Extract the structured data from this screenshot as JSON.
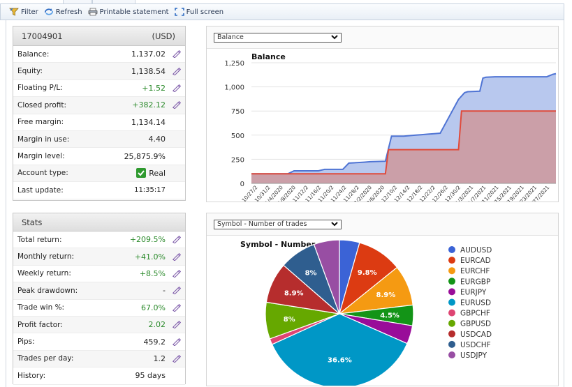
{
  "toolbar": {
    "filter": "Filter",
    "refresh": "Refresh",
    "printable": "Printable statement",
    "fullscreen": "Full screen"
  },
  "account": {
    "number": "17004901",
    "currency": "(USD)",
    "rows": [
      {
        "label": "Balance:",
        "value": "1,137.02",
        "style": "",
        "edit": true
      },
      {
        "label": "Equity:",
        "value": "1,138.54",
        "style": "",
        "edit": true
      },
      {
        "label": "Floating P/L:",
        "value": "+1.52",
        "style": "green",
        "edit": true
      },
      {
        "label": "Closed profit:",
        "value": "+382.12",
        "style": "green",
        "edit": true
      },
      {
        "label": "Free margin:",
        "value": "1,134.14",
        "style": "",
        "edit": false
      },
      {
        "label": "Margin in use:",
        "value": "4.40",
        "style": "",
        "edit": false
      },
      {
        "label": "Margin level:",
        "value": "25,875.9%",
        "style": "",
        "edit": false
      },
      {
        "label": "Account type:",
        "value": "Real",
        "style": "",
        "edit": false,
        "check": true
      },
      {
        "label": "Last update:",
        "value": "11:35:17",
        "style": "small",
        "edit": false
      }
    ]
  },
  "stats": {
    "title": "Stats",
    "rows": [
      {
        "label": "Total return:",
        "value": "+209.5%",
        "style": "green"
      },
      {
        "label": "Monthly return:",
        "value": "+41.0%",
        "style": "green"
      },
      {
        "label": "Weekly return:",
        "value": "+8.5%",
        "style": "green"
      },
      {
        "label": "Peak drawdown:",
        "value": "-",
        "style": ""
      },
      {
        "label": "Trade win %:",
        "value": "67.0%",
        "style": "green"
      },
      {
        "label": "Profit factor:",
        "value": "2.02",
        "style": "green"
      },
      {
        "label": "Pips:",
        "value": "459.2",
        "style": ""
      },
      {
        "label": "Trades per day:",
        "value": "1.2",
        "style": ""
      },
      {
        "label": "History:",
        "value": "95 days",
        "style": "",
        "noedit": true
      }
    ]
  },
  "balance_select": "Balance",
  "pie_select": "Symbol - Number of trades",
  "chart_data": [
    {
      "type": "area",
      "title": "Balance",
      "ylim": [
        0,
        1250
      ],
      "yticks": [
        0,
        250,
        500,
        750,
        1000,
        1250
      ],
      "xticklabels": [
        "10/27/2",
        "10/31/2",
        "11/4/2020",
        "11/8/2020",
        "11/12/2",
        "11/16/2",
        "11/20/2",
        "11/24/2",
        "11/28/2",
        "12/2/2020",
        "12/6/2020",
        "12/10/2",
        "12/14/2",
        "12/18/2",
        "12/22/2",
        "12/26/2",
        "12/30/2",
        "1/3/2021",
        "1/7/2021",
        "1/11/2021",
        "1/15/2021",
        "1/19/2021",
        "1/23/2021",
        "1/27/2021"
      ],
      "series": [
        {
          "color": "#4f74d4",
          "fill": "#b8c8ee",
          "x": [
            0,
            0.12,
            0.14,
            0.22,
            0.24,
            0.3,
            0.32,
            0.37,
            0.39,
            0.44,
            0.46,
            0.5,
            0.54,
            0.56,
            0.58,
            0.6,
            0.62,
            0.68,
            0.7,
            0.71,
            0.75,
            0.76,
            0.77,
            0.8,
            0.81,
            0.84,
            0.86,
            0.9,
            0.93,
            0.97,
            0.99,
            1.0
          ],
          "y": [
            100,
            100,
            130,
            130,
            145,
            145,
            210,
            220,
            225,
            230,
            490,
            490,
            500,
            505,
            510,
            515,
            520,
            870,
            940,
            950,
            955,
            1090,
            1100,
            1105,
            1105,
            1105,
            1105,
            1105,
            1105,
            1105,
            1130,
            1137
          ]
        },
        {
          "color": "#e04a3a",
          "fill": "#cd9aa0",
          "x": [
            0,
            0.44,
            0.45,
            0.68,
            0.69,
            1.0
          ],
          "y": [
            100,
            100,
            350,
            350,
            750,
            750
          ]
        }
      ]
    },
    {
      "type": "pie",
      "title": "Symbol - Number of trades",
      "categories": [
        "AUDUSD",
        "EURCAD",
        "EURCHF",
        "EURGBP",
        "EURJPY",
        "EURUSD",
        "GBPCHF",
        "GBPUSD",
        "USDCAD",
        "USDCHF",
        "USDJPY"
      ],
      "values": [
        4.4,
        9.8,
        8.9,
        4.5,
        4.0,
        36.6,
        1.3,
        8.0,
        8.9,
        8.0,
        5.6
      ],
      "labels": [
        "",
        "9.8%",
        "8.9%",
        "4.5%",
        "",
        "36.6%",
        "",
        "8%",
        "8.9%",
        "8%",
        ""
      ],
      "colors": [
        "#3b63d6",
        "#dc3b12",
        "#f59a12",
        "#139417",
        "#990c99",
        "#0097c6",
        "#de4573",
        "#66a800",
        "#b62d2d",
        "#2f5e8f",
        "#984ea3"
      ]
    }
  ]
}
